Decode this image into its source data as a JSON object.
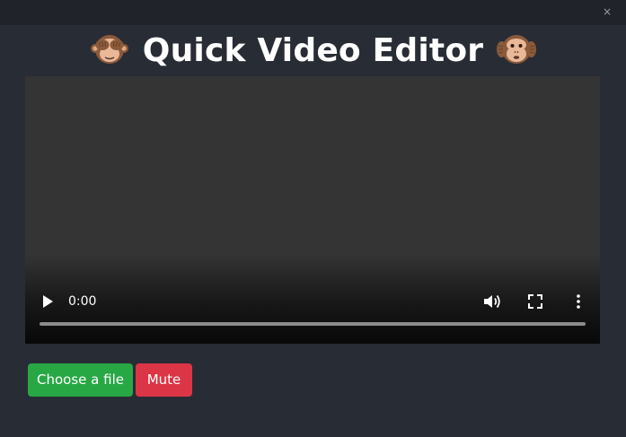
{
  "window": {
    "close_glyph": "×",
    "close_icon": "close-icon"
  },
  "header": {
    "title": "Quick Video Editor",
    "left_emoji": "see-no-evil-monkey",
    "right_emoji": "hear-no-evil-monkey"
  },
  "video": {
    "current_time": "0:00",
    "progress": 0,
    "icons": [
      "play-icon",
      "volume-icon",
      "fullscreen-icon",
      "more-options-icon"
    ]
  },
  "actions": {
    "choose_file_label": "Choose a file",
    "mute_label": "Mute"
  },
  "colors": {
    "background": "#282c34",
    "titlebar": "#202329",
    "choose_file_button": "#28a745",
    "mute_button": "#dc3545",
    "video_surface": "#343434"
  }
}
